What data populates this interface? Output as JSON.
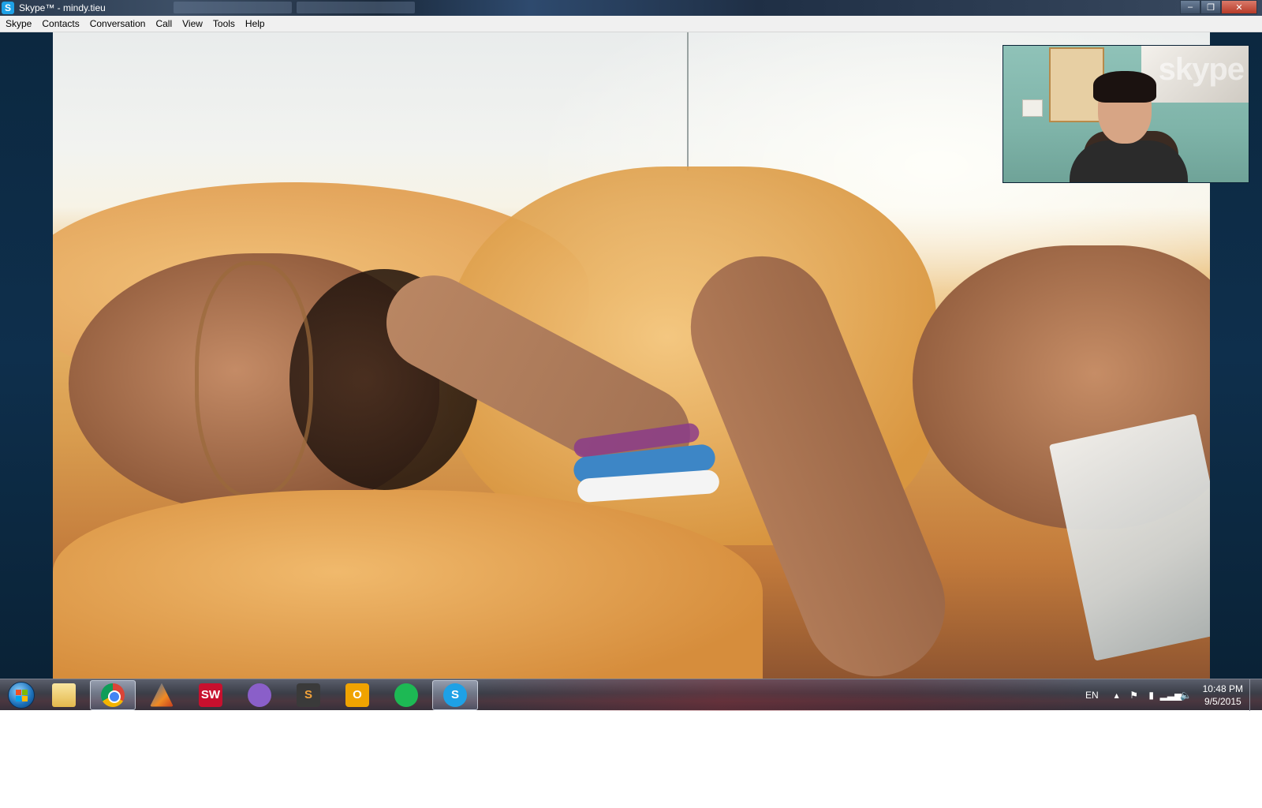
{
  "window": {
    "title": "Skype™ - mindy.tieu",
    "app_icon": "S",
    "controls": {
      "minimize": "–",
      "maximize": "❐",
      "close": "✕"
    }
  },
  "menu": [
    {
      "label": "Skype"
    },
    {
      "label": "Contacts"
    },
    {
      "label": "Conversation"
    },
    {
      "label": "Call"
    },
    {
      "label": "View"
    },
    {
      "label": "Tools"
    },
    {
      "label": "Help"
    }
  ],
  "call": {
    "main_video_description": "remote-video-feed",
    "self_view_watermark": "skype"
  },
  "taskbar": {
    "apps": [
      {
        "name": "windows-explorer"
      },
      {
        "name": "google-chrome",
        "active": true
      },
      {
        "name": "matlab"
      },
      {
        "name": "solidworks",
        "glyph": "SW"
      },
      {
        "name": "github"
      },
      {
        "name": "sublime-text",
        "glyph": "S"
      },
      {
        "name": "outlook",
        "glyph": "O"
      },
      {
        "name": "spotify"
      },
      {
        "name": "skype",
        "glyph": "S",
        "active": true
      }
    ],
    "tray": {
      "language": "EN",
      "time": "10:48 PM",
      "date": "9/5/2015"
    }
  },
  "colors": {
    "skype_blue": "#1ea1e6",
    "call_background": "#0e2f4c",
    "menubar": "#f0f0f0"
  }
}
